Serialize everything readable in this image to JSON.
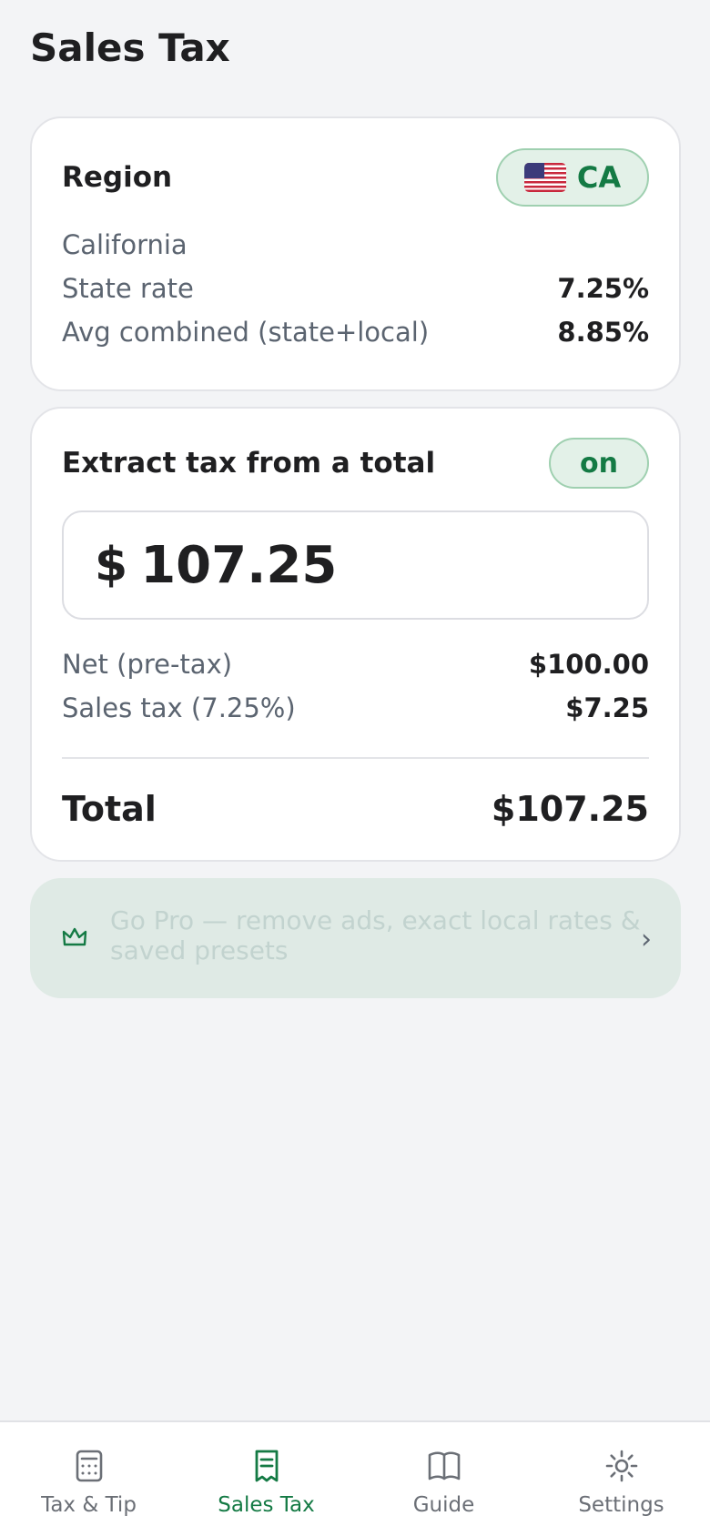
{
  "header": {
    "title": "Sales Tax"
  },
  "region_card": {
    "title": "Region",
    "region_code": "CA",
    "flag_icon": "us-flag-icon",
    "region_name": "California",
    "state_rate_label": "State rate",
    "state_rate_value": "7.25%",
    "avg_combined_label": "Avg combined (state+local)",
    "avg_combined_value": "8.85%"
  },
  "extract_card": {
    "title": "Extract tax from a total",
    "toggle_label": "on",
    "currency_symbol": "$",
    "amount_value": "107.25",
    "net_label": "Net (pre-tax)",
    "net_value": "$100.00",
    "tax_label": "Sales tax (7.25%)",
    "tax_value": "$7.25",
    "total_label": "Total",
    "total_value": "$107.25"
  },
  "promo": {
    "text": "Go Pro — remove ads, exact local rates & saved presets",
    "icon": "crown-icon",
    "chevron": "›"
  },
  "tabbar": {
    "tabs": [
      {
        "label": "Tax & Tip",
        "icon": "calculator-icon",
        "active": false
      },
      {
        "label": "Sales Tax",
        "icon": "receipt-icon",
        "active": true
      },
      {
        "label": "Guide",
        "icon": "book-icon",
        "active": false
      },
      {
        "label": "Settings",
        "icon": "gear-icon",
        "active": false
      }
    ]
  },
  "colors": {
    "accent": "#147a44",
    "accent_bg": "#e3f1e8",
    "background": "#f3f4f6",
    "promo_bg": "#dfeae5"
  }
}
